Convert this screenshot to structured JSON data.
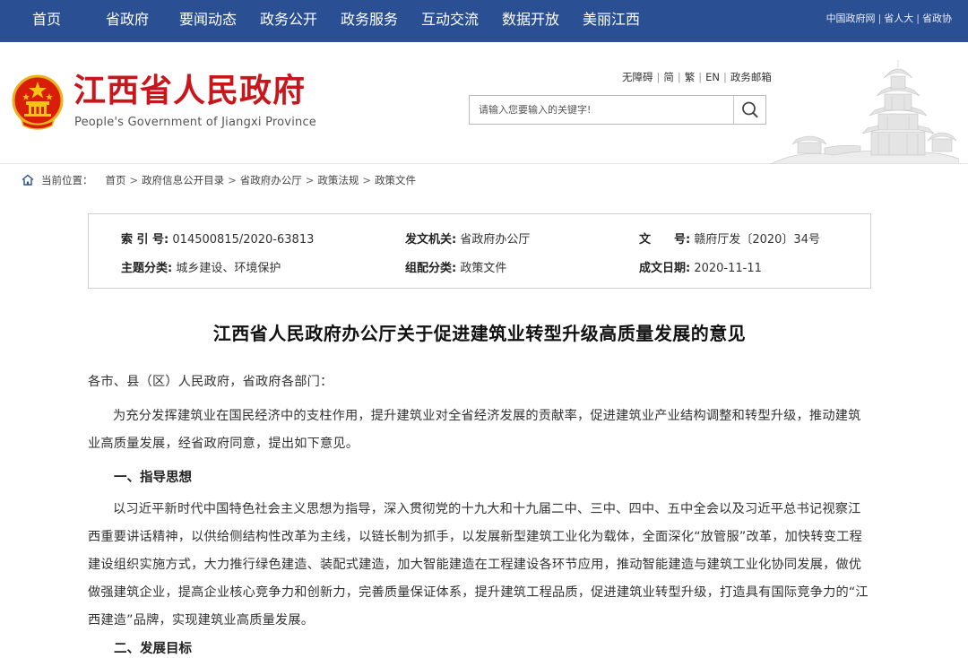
{
  "nav": {
    "items": [
      "首页",
      "省政府",
      "要闻动态",
      "政务公开",
      "政务服务",
      "互动交流",
      "数据开放",
      "美丽江西"
    ],
    "links": [
      "中国政府网",
      "省人大",
      "省政协"
    ]
  },
  "header": {
    "title": "江西省人民政府",
    "subtitle": "People's Government of Jiangxi Province",
    "util_links": [
      "无障碍",
      "简",
      "繁",
      "EN",
      "政务邮箱"
    ],
    "search_placeholder": "请输入您要输入的关键字!"
  },
  "breadcrumb": {
    "label": "当前位置：",
    "items": [
      "首页",
      "政府信息公开目录",
      "省政府办公厅",
      "政策法规",
      "政策文件"
    ]
  },
  "info": {
    "index_label": "索 引 号:",
    "index_value": "014500815/2020-63813",
    "issuer_label": "发文机关:",
    "issuer_value": "省政府办公厅",
    "docno_label": "文　　号:",
    "docno_value": "赣府厅发〔2020〕34号",
    "topic_label": "主题分类:",
    "topic_value": "城乡建设、环境保护",
    "category_label": "组配分类:",
    "category_value": "政策文件",
    "date_label": "成文日期:",
    "date_value": "2020-11-11"
  },
  "article": {
    "title": "江西省人民政府办公厅关于促进建筑业转型升级高质量发展的意见",
    "greeting": "各市、县（区）人民政府，省政府各部门：",
    "intro": "为充分发挥建筑业在国民经济中的支柱作用，提升建筑业对全省经济发展的贡献率，促进建筑业产业结构调整和转型升级，推动建筑业高质量发展，经省政府同意，提出如下意见。",
    "section1_heading": "一、指导思想",
    "section1_body": "以习近平新时代中国特色社会主义思想为指导，深入贯彻党的十九大和十九届二中、三中、四中、五中全会以及习近平总书记视察江西重要讲话精神，以供给侧结构性改革为主线，以链长制为抓手，以发展新型建筑工业化为载体，全面深化“放管服”改革，加快转变工程建设组织实施方式，大力推行绿色建造、装配式建造，加大智能建造在工程建设各环节应用，推动智能建造与建筑工业化协同发展，做优做强建筑企业，提高企业核心竞争力和创新力，完善质量保证体系，提升建筑工程品质，促进建筑业转型升级，打造具有国际竞争力的“江西建造”品牌，实现建筑业高质量发展。",
    "section2_heading": "二、发展目标"
  },
  "colors": {
    "nav_bg": "#2a4f92",
    "title_red": "#c8161d"
  }
}
